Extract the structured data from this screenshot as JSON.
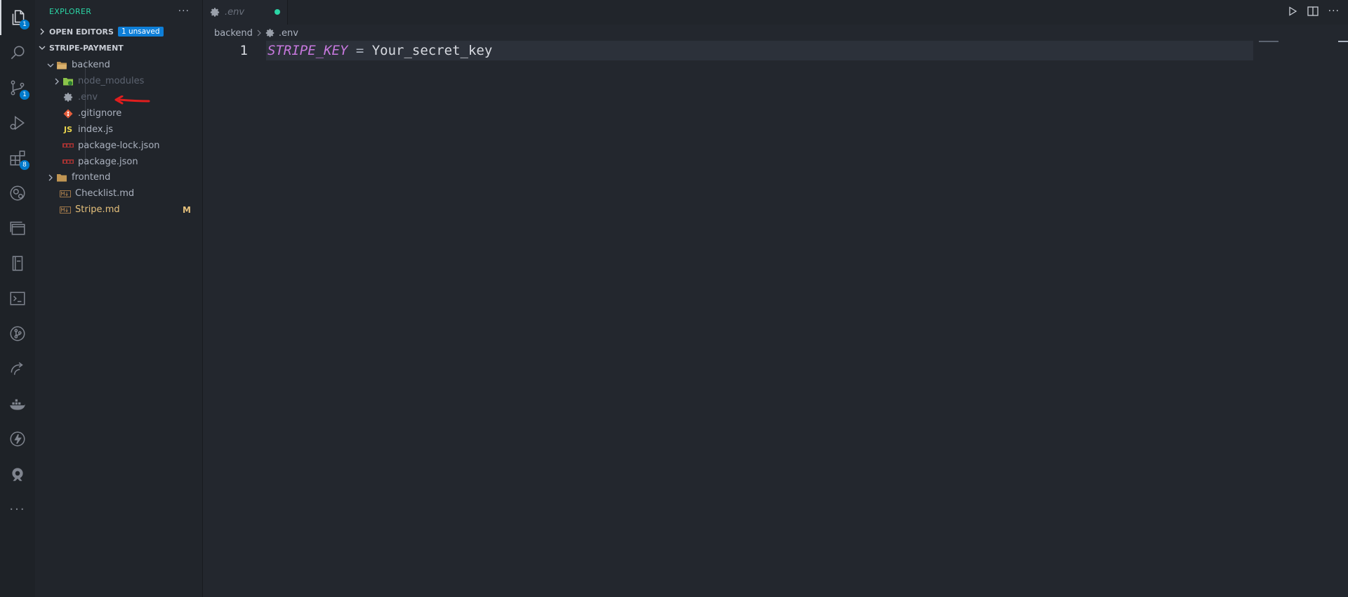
{
  "activity_bar": {
    "items": [
      {
        "name": "explorer",
        "badge": "1"
      },
      {
        "name": "search",
        "badge": ""
      },
      {
        "name": "source-control",
        "badge": "1"
      },
      {
        "name": "run-debug",
        "badge": ""
      },
      {
        "name": "extensions",
        "badge": "8"
      },
      {
        "name": "remote-explorer",
        "badge": ""
      },
      {
        "name": "pages",
        "badge": ""
      },
      {
        "name": "book",
        "badge": ""
      },
      {
        "name": "terminal",
        "badge": ""
      },
      {
        "name": "git-graph",
        "badge": ""
      },
      {
        "name": "live-share",
        "badge": ""
      },
      {
        "name": "docker",
        "badge": ""
      },
      {
        "name": "thunder-client",
        "badge": ""
      },
      {
        "name": "gitkraken",
        "badge": ""
      },
      {
        "name": "more",
        "badge": ""
      }
    ]
  },
  "sidebar": {
    "title": "EXPLORER",
    "more": "···",
    "open_editors": {
      "label": "OPEN EDITORS",
      "badge": "1 unsaved"
    },
    "project": {
      "label": "STRIPE-PAYMENT"
    },
    "tree": [
      {
        "label": "backend",
        "type": "folder-open"
      },
      {
        "label": "node_modules",
        "type": "folder-node"
      },
      {
        "label": ".env",
        "type": "env"
      },
      {
        "label": ".gitignore",
        "type": "git"
      },
      {
        "label": "index.js",
        "type": "js"
      },
      {
        "label": "package-lock.json",
        "type": "npm"
      },
      {
        "label": "package.json",
        "type": "npm"
      },
      {
        "label": "frontend",
        "type": "folder"
      },
      {
        "label": "Checklist.md",
        "type": "md"
      },
      {
        "label": "Stripe.md",
        "type": "md",
        "status": "M"
      }
    ]
  },
  "tabs": [
    {
      "label": ".env",
      "unsaved": true
    }
  ],
  "breadcrumb": {
    "parts": [
      "backend",
      ".env"
    ]
  },
  "editor": {
    "lines": [
      {
        "number": "1",
        "key": "STRIPE_KEY",
        "op": " = ",
        "value": "Your_secret_key"
      }
    ]
  },
  "colors": {
    "accent": "#2bd6a6",
    "badge": "#007acc",
    "annotation": "#e01e1e",
    "keyword": "#c678dd"
  }
}
